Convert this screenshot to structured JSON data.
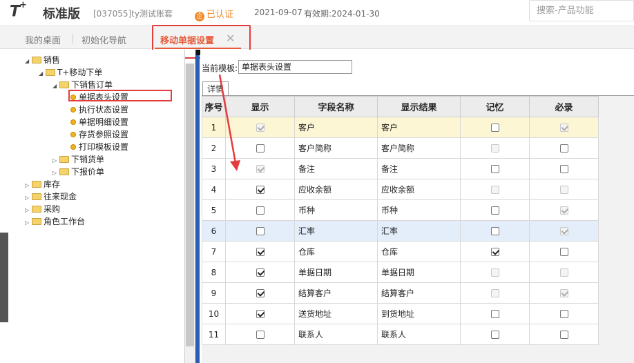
{
  "header": {
    "logo": "T",
    "logo_plus": "+",
    "edition": "标准版",
    "account": "[037055]ty测试账套",
    "cert_icon": "企",
    "cert_label": "已认证",
    "date": "2021-09-07",
    "validity": "有效期:2024-01-30",
    "search_placeholder": "搜索-产品功能"
  },
  "tabs": {
    "home": "我的桌面",
    "guide": "初始化导航",
    "active": "移动单据设置",
    "close": "✕"
  },
  "tree": [
    {
      "label": "销售",
      "type": "folder",
      "expanded": true
    },
    {
      "label": "T+移动下单",
      "type": "folder",
      "expanded": true
    },
    {
      "label": "下销售订单",
      "type": "folder",
      "expanded": true
    },
    {
      "label": "单据表头设置",
      "type": "leaf",
      "selected": true
    },
    {
      "label": "执行状态设置",
      "type": "leaf"
    },
    {
      "label": "单据明细设置",
      "type": "leaf"
    },
    {
      "label": "存货参照设置",
      "type": "leaf"
    },
    {
      "label": "打印模板设置",
      "type": "leaf"
    },
    {
      "label": "下销货单",
      "type": "folder",
      "expanded": false
    },
    {
      "label": "下报价单",
      "type": "folder",
      "expanded": false
    },
    {
      "label": "库存",
      "type": "folder",
      "expanded": false
    },
    {
      "label": "往来现金",
      "type": "folder",
      "expanded": false
    },
    {
      "label": "采购",
      "type": "folder",
      "expanded": false
    },
    {
      "label": "角色工作台",
      "type": "folder",
      "expanded": false
    }
  ],
  "template": {
    "label": "当前模板:",
    "value": "单据表头设置"
  },
  "subtab": "详情",
  "table": {
    "columns": [
      "序号",
      "显示",
      "字段名称",
      "显示结果",
      "记忆",
      "必录"
    ],
    "rows": [
      {
        "no": "1",
        "show": true,
        "show_dis": true,
        "name": "客户",
        "result": "客户",
        "mem": false,
        "mem_dis": false,
        "req": true,
        "req_dis": true
      },
      {
        "no": "2",
        "show": false,
        "show_dis": false,
        "name": "客户简称",
        "result": "客户简称",
        "mem": false,
        "mem_dis": true,
        "req": false,
        "req_dis": false
      },
      {
        "no": "3",
        "show": true,
        "show_dis": true,
        "name": "备注",
        "result": "备注",
        "mem": false,
        "mem_dis": false,
        "req": false,
        "req_dis": false
      },
      {
        "no": "4",
        "show": true,
        "show_dis": false,
        "name": "应收余额",
        "result": "应收余额",
        "mem": false,
        "mem_dis": true,
        "req": false,
        "req_dis": true
      },
      {
        "no": "5",
        "show": false,
        "show_dis": false,
        "name": "币种",
        "result": "币种",
        "mem": false,
        "mem_dis": false,
        "req": true,
        "req_dis": true
      },
      {
        "no": "6",
        "show": false,
        "show_dis": false,
        "name": "汇率",
        "result": "汇率",
        "mem": false,
        "mem_dis": false,
        "req": true,
        "req_dis": true
      },
      {
        "no": "7",
        "show": true,
        "show_dis": false,
        "name": "仓库",
        "result": "仓库",
        "mem": true,
        "mem_dis": false,
        "req": false,
        "req_dis": false
      },
      {
        "no": "8",
        "show": true,
        "show_dis": false,
        "name": "单据日期",
        "result": "单据日期",
        "mem": false,
        "mem_dis": true,
        "req": false,
        "req_dis": true
      },
      {
        "no": "9",
        "show": true,
        "show_dis": false,
        "name": "结算客户",
        "result": "结算客户",
        "mem": false,
        "mem_dis": true,
        "req": true,
        "req_dis": true
      },
      {
        "no": "10",
        "show": true,
        "show_dis": false,
        "name": "送货地址",
        "result": "到货地址",
        "mem": false,
        "mem_dis": false,
        "req": false,
        "req_dis": false
      },
      {
        "no": "11",
        "show": false,
        "show_dis": false,
        "name": "联系人",
        "result": "联系人",
        "mem": false,
        "mem_dis": false,
        "req": false,
        "req_dis": false
      }
    ]
  },
  "colors": {
    "accent": "#e65a3a",
    "annotation": "#e23c3c",
    "selected_row": "#fdf6d4",
    "hover_row": "#e4eefb"
  }
}
